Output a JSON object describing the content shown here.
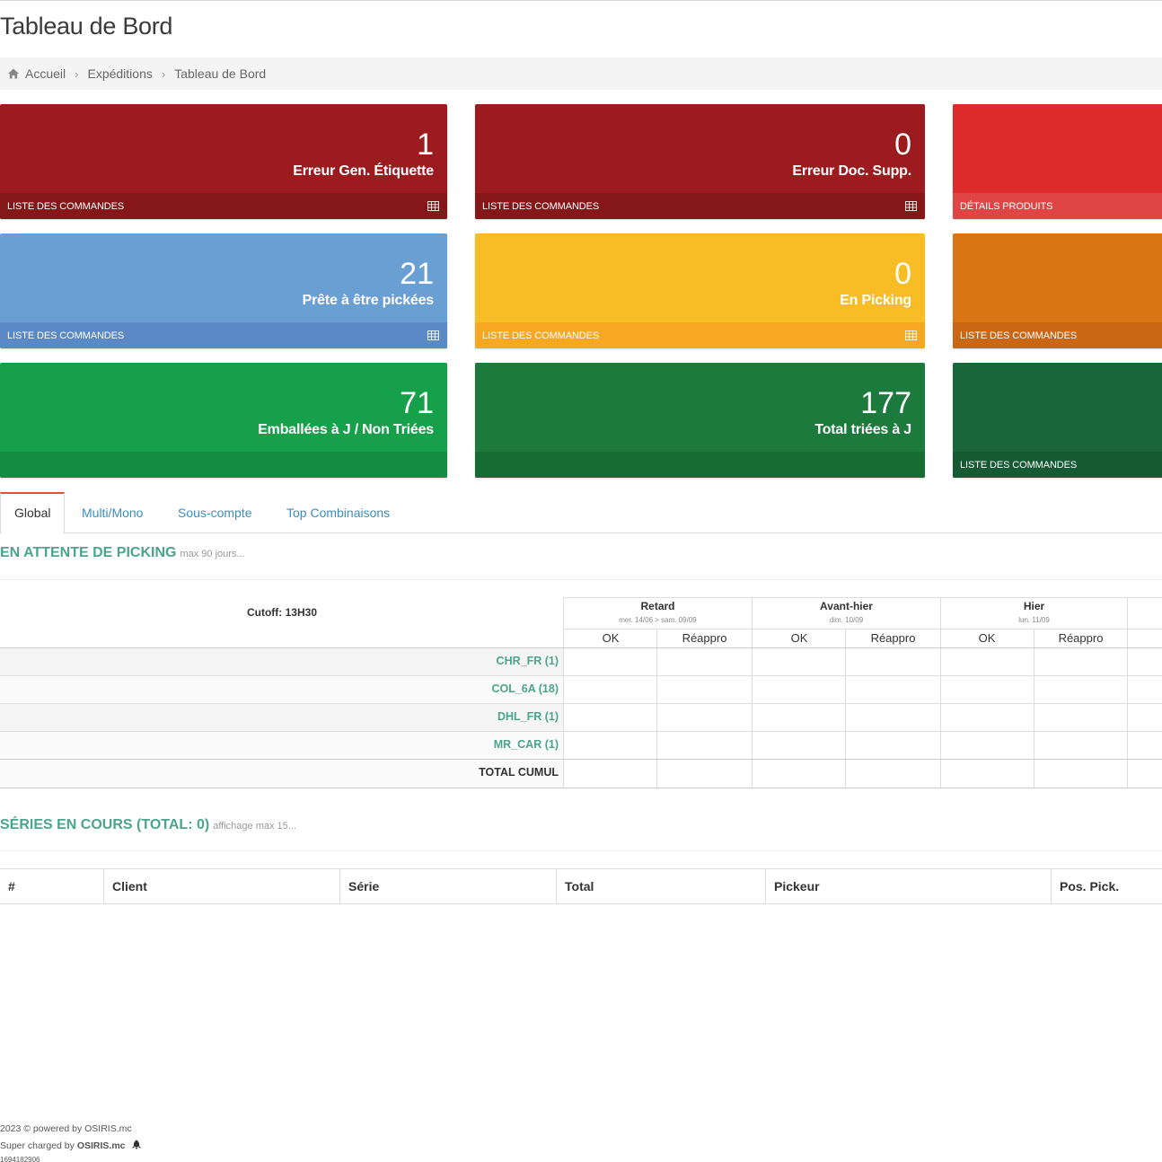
{
  "page": {
    "title": "Tableau de Bord"
  },
  "breadcrumb": {
    "home": "Accueil",
    "section": "Expéditions",
    "current": "Tableau de Bord"
  },
  "tiles": [
    {
      "id": "etiquette",
      "number": "1",
      "label": "Erreur Gen. Étiquette",
      "footer": "LISTE DES COMMANDES",
      "color": "#9b1b1e",
      "footer_color": "#851719"
    },
    {
      "id": "docsupp",
      "number": "0",
      "label": "Erreur Doc. Supp.",
      "footer": "LISTE DES COMMANDES",
      "color": "#9b1b1e",
      "footer_color": "#851719"
    },
    {
      "id": "produits",
      "number": "",
      "label": "",
      "footer": "DÉTAILS PRODUITS",
      "color": "#dd2b2b",
      "footer_color": "#e04545"
    },
    {
      "id": "pickees",
      "number": "21",
      "label": "Prête à être pickées",
      "footer": "LISTE DES COMMANDES",
      "color": "#6a9fd4",
      "footer_color": "#5b89c6"
    },
    {
      "id": "picking",
      "number": "0",
      "label": "En Picking",
      "footer": "LISTE DES COMMANDES",
      "color": "#f8bd25",
      "footer_color": "#f6a823"
    },
    {
      "id": "orange",
      "number": "",
      "label": "",
      "footer": "LISTE DES COMMANDES",
      "color": "#d97512",
      "footer_color": "#c96714"
    },
    {
      "id": "emballees",
      "number": "71",
      "label": "Emballées à J / Non Triées",
      "footer": "",
      "color": "#16a04a",
      "footer_color": "#138d40"
    },
    {
      "id": "triees",
      "number": "177",
      "label": "Total triées à J",
      "footer": "",
      "color": "#1b7a3c",
      "footer_color": "#176c34"
    },
    {
      "id": "darkgreen",
      "number": "",
      "label": "",
      "footer": "LISTE DES COMMANDES",
      "color": "#18663a",
      "footer_color": "#155a32"
    }
  ],
  "tabs": [
    "Global",
    "Multi/Mono",
    "Sous-compte",
    "Top Combinaisons"
  ],
  "picking": {
    "title": "EN ATTENTE DE PICKING",
    "subtitle": "max 90 jours...",
    "cutoff": "Cutoff: 13H30",
    "columns": [
      {
        "name": "Retard",
        "date": "mer. 14/06 > sam. 09/09",
        "sub": [
          "OK",
          "Réappro"
        ]
      },
      {
        "name": "Avant-hier",
        "date": "dim. 10/09",
        "sub": [
          "OK",
          "Réappro"
        ]
      },
      {
        "name": "Hier",
        "date": "lun. 11/09",
        "sub": [
          "OK",
          "Réappro"
        ]
      }
    ],
    "rows": [
      "CHR_FR (1)",
      "COL_6A (18)",
      "DHL_FR (1)",
      "MR_CAR (1)"
    ],
    "total_label": "TOTAL CUMUL"
  },
  "series": {
    "title": "SÉRIES EN COURS (TOTAL: 0)",
    "subtitle": "affichage max 15...",
    "headers": [
      "#",
      "Client",
      "Série",
      "Total",
      "Pickeur",
      "Pos. Pick."
    ]
  },
  "footer": {
    "line1": "2023 © powered by OSIRIS.mc",
    "line2_prefix": "Super charged by ",
    "line2_brand": "OSIRIS.mc",
    "line3": "1694182906"
  }
}
